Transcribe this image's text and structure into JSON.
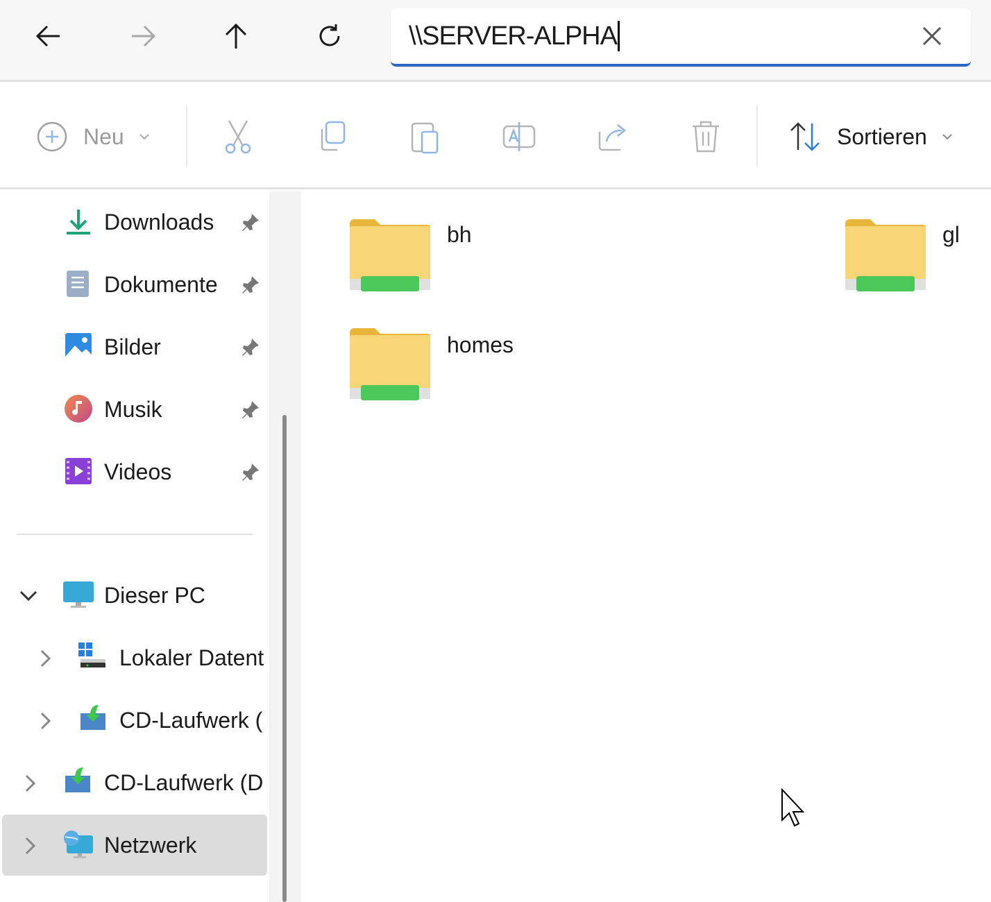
{
  "nav": {
    "back": "arrow-left-icon",
    "forward": "arrow-right-icon",
    "up": "arrow-up-icon",
    "refresh": "refresh-icon"
  },
  "address": {
    "value": "\\\\SERVER-ALPHA",
    "clear": "close-icon"
  },
  "toolbar": {
    "new_label": "Neu",
    "sort_label": "Sortieren"
  },
  "sidebar": {
    "quick": [
      {
        "label": "Downloads",
        "icon": "download-icon"
      },
      {
        "label": "Dokumente",
        "icon": "document-icon"
      },
      {
        "label": "Bilder",
        "icon": "pictures-icon"
      },
      {
        "label": "Musik",
        "icon": "music-icon"
      },
      {
        "label": "Videos",
        "icon": "video-icon"
      }
    ],
    "tree": [
      {
        "label": "Dieser PC",
        "icon": "computer-icon",
        "expanded": true
      },
      {
        "label": "Lokaler Datent",
        "icon": "local-disk-icon"
      },
      {
        "label": "CD-Laufwerk (",
        "icon": "cd-drive-icon"
      },
      {
        "label": "CD-Laufwerk (D",
        "icon": "cd-drive-icon"
      },
      {
        "label": "Netzwerk",
        "icon": "network-icon",
        "selected": true
      }
    ]
  },
  "content": {
    "folders": [
      {
        "name": "bh"
      },
      {
        "name": "gl"
      },
      {
        "name": "homes"
      }
    ]
  },
  "colors": {
    "accent": "#2a66c2",
    "selected": "#dcdcdc"
  }
}
